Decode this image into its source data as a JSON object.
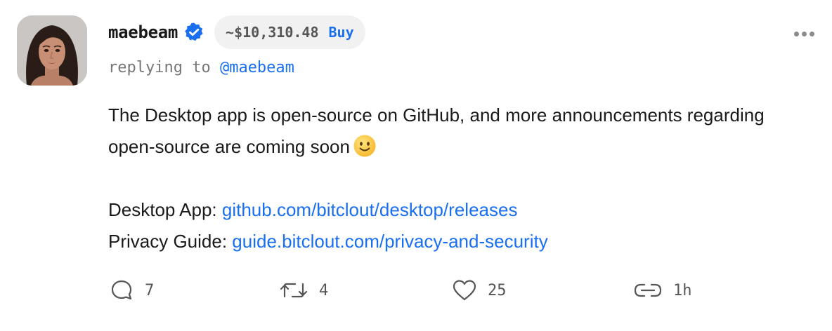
{
  "post": {
    "username": "maebeam",
    "price": "~$10,310.48",
    "buy_label": "Buy",
    "replying_prefix": "replying to",
    "replying_mention": "@maebeam",
    "body_line1": "The Desktop app is open-source on GitHub, and more announcements regarding open-source are coming soon",
    "emoji": "slightly-smiling-face",
    "desktop_label": "Desktop App: ",
    "desktop_link": "github.com/bitclout/desktop/releases",
    "privacy_label": "Privacy Guide: ",
    "privacy_link": "guide.bitclout.com/privacy-and-security"
  },
  "actions": {
    "comments": "7",
    "reclouts": "4",
    "likes": "25",
    "time": "1h"
  },
  "colors": {
    "accent": "#1a6ff0",
    "verified": "#1a6ff0",
    "muted": "#777777",
    "pill_bg": "#f1f1f1"
  },
  "icons": {
    "avatar": "avatar",
    "verified": "verified-badge-icon",
    "more": "more-horizontal-icon",
    "comment": "comment-icon",
    "reclout": "reclout-icon",
    "like": "heart-icon",
    "link": "link-icon"
  }
}
